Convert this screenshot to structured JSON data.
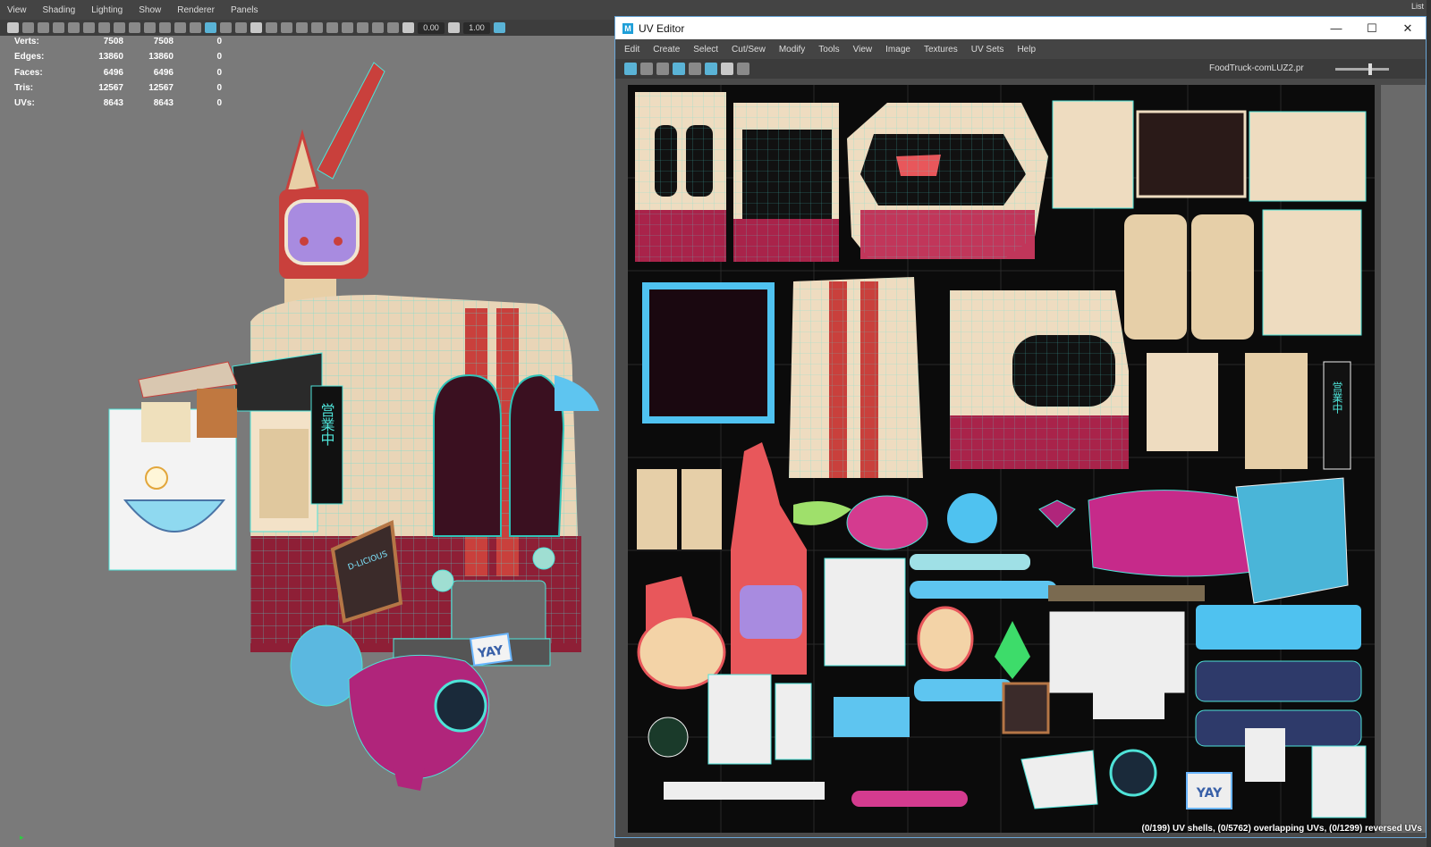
{
  "viewport": {
    "menu": [
      "View",
      "Shading",
      "Lighting",
      "Show",
      "Renderer",
      "Panels"
    ],
    "toolbar": {
      "exposure": "0.00",
      "gamma": "1.00"
    },
    "hud": [
      {
        "label": "Verts:",
        "a": "7508",
        "b": "7508",
        "c": "0"
      },
      {
        "label": "Edges:",
        "a": "13860",
        "b": "13860",
        "c": "0"
      },
      {
        "label": "Faces:",
        "a": "6496",
        "b": "6496",
        "c": "0"
      },
      {
        "label": "Tris:",
        "a": "12567",
        "b": "12567",
        "c": "0"
      },
      {
        "label": "UVs:",
        "a": "8643",
        "b": "8643",
        "c": "0"
      }
    ],
    "signboard_text": "営業中",
    "menu_board_text": "D-LICIOUS",
    "plate_text": "YAY"
  },
  "uv_editor": {
    "title": "UV Editor",
    "window_controls": {
      "minimize": "—",
      "maximize": "☐",
      "close": "✕"
    },
    "menu": [
      "Edit",
      "Create",
      "Select",
      "Cut/Sew",
      "Modify",
      "Tools",
      "View",
      "Image",
      "Textures",
      "UV Sets",
      "Help"
    ],
    "texture_name": "FoodTruck-comLUZ2.pr",
    "status": "(0/199) UV shells, (0/5762) overlapping UVs, (0/1299) reversed UVs",
    "sign_text": "営業中",
    "plate_text": "YAY"
  },
  "top_right_label": "List"
}
